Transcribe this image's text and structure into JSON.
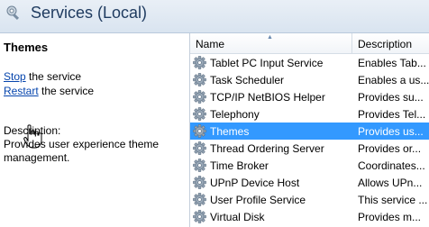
{
  "header": {
    "title": "Services (Local)",
    "icon": "services-gear-icon"
  },
  "details": {
    "title": "Themes",
    "stop_link": "Stop",
    "stop_suffix": " the service",
    "restart_link": "Restart",
    "restart_suffix": " the service",
    "description_label": "Description:",
    "description_text": "Provides user experience theme management."
  },
  "table": {
    "columns": [
      "Name",
      "Description"
    ],
    "rows": [
      {
        "name": "Tablet PC Input Service",
        "description": "Enables Tab..."
      },
      {
        "name": "Task Scheduler",
        "description": "Enables a us..."
      },
      {
        "name": "TCP/IP NetBIOS Helper",
        "description": "Provides su..."
      },
      {
        "name": "Telephony",
        "description": "Provides Tel..."
      },
      {
        "name": "Themes",
        "description": "Provides us...",
        "selected": true
      },
      {
        "name": "Thread Ordering Server",
        "description": "Provides or..."
      },
      {
        "name": "Time Broker",
        "description": "Coordinates..."
      },
      {
        "name": "UPnP Device Host",
        "description": "Allows UPn..."
      },
      {
        "name": "User Profile Service",
        "description": "This service ..."
      },
      {
        "name": "Virtual Disk",
        "description": "Provides m..."
      }
    ]
  },
  "colors": {
    "selection": "#3399ff",
    "link": "#0645ad",
    "title": "#1e3a5f"
  }
}
